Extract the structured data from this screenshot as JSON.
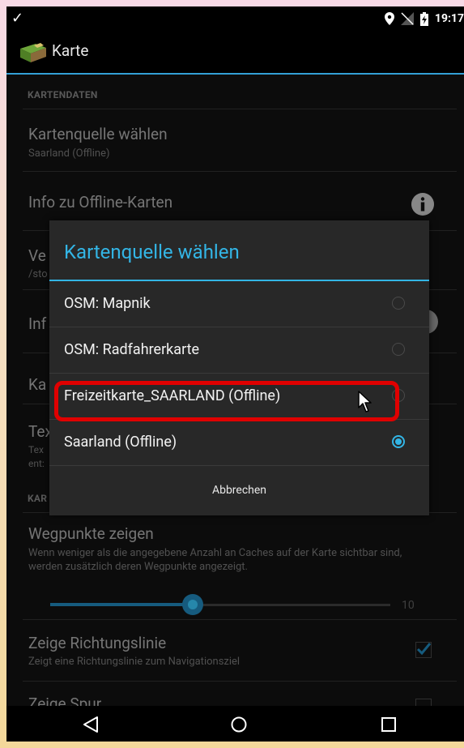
{
  "statusbar": {
    "time": "19:17"
  },
  "appbar": {
    "title": "Karte"
  },
  "settings": {
    "section1": "KARTENDATEN",
    "map_source_title": "Kartenquelle wählen",
    "map_source_value": "Saarland (Offline)",
    "offline_info_title": "Info zu Offline-Karten",
    "partial_row1": "Ve",
    "partial_row1_sub": "/sto",
    "partial_row2": "Inf",
    "partial_row3": "Ka",
    "partial_row4": "Tex",
    "partial_row4_sub1": "Tex",
    "partial_row4_sub2": "ent:",
    "section2_partial": "KAR",
    "waypoints_title": "Wegpunkte zeigen",
    "waypoints_sub": "Wenn weniger als die angegebene Anzahl an Caches auf der Karte sichtbar sind, werden zusätzlich deren Wegpunkte angezeigt.",
    "slider_value": "10",
    "slider_level": 0.42,
    "direction_title": "Zeige Richtungslinie",
    "direction_sub": "Zeigt eine Richtungslinie zum Navigationsziel",
    "direction_checked": true,
    "track_title": "Zeige Spur"
  },
  "dialog": {
    "title": "Kartenquelle wählen",
    "options": [
      {
        "label": "OSM: Mapnik",
        "selected": false
      },
      {
        "label": "OSM: Radfahrerkarte",
        "selected": false
      },
      {
        "label": "Freizeitkarte_SAARLAND (Offline)",
        "selected": false
      },
      {
        "label": "Saarland (Offline)",
        "selected": true
      }
    ],
    "cancel_label": "Abbrechen"
  },
  "colors": {
    "accent": "#33b5e5",
    "highlight": "#e00000"
  }
}
